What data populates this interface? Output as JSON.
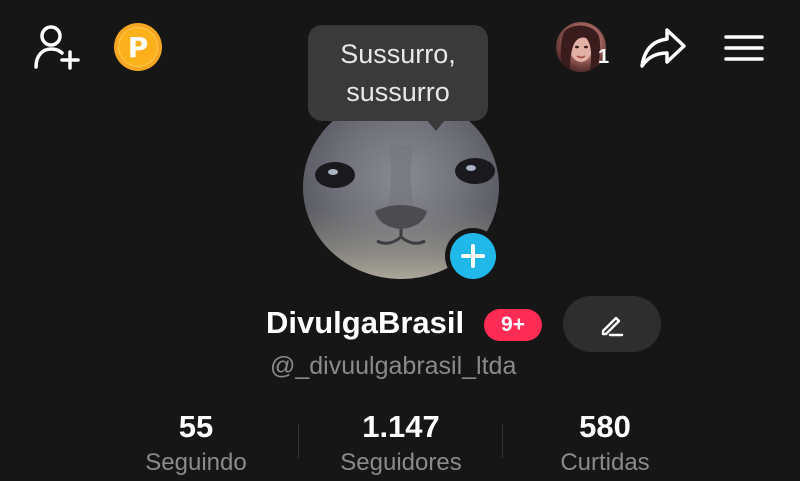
{
  "header": {
    "add_friend_icon": "person-add-icon",
    "coin_icon": "coin-icon",
    "coin_letter": "P",
    "friends_notification_count": "1",
    "share_icon": "share-icon",
    "menu_icon": "hamburger-menu-icon"
  },
  "tooltip": {
    "line1": "Sussurro,",
    "line2": "sussurro"
  },
  "profile": {
    "avatar_icon": "profile-photo",
    "add_icon": "plus-icon",
    "username": "DivulgaBrasil",
    "badge": "9+",
    "edit_icon": "pencil-icon",
    "handle": "@_divuulgabrasil_ltda"
  },
  "stats": [
    {
      "value": "55",
      "label": "Seguindo"
    },
    {
      "value": "1.147",
      "label": "Seguidores"
    },
    {
      "value": "580",
      "label": "Curtidas"
    }
  ],
  "colors": {
    "background": "#161616",
    "accent_blue": "#20b8e8",
    "badge_red": "#fe2c55",
    "coin_gold": "#fcb11c"
  }
}
